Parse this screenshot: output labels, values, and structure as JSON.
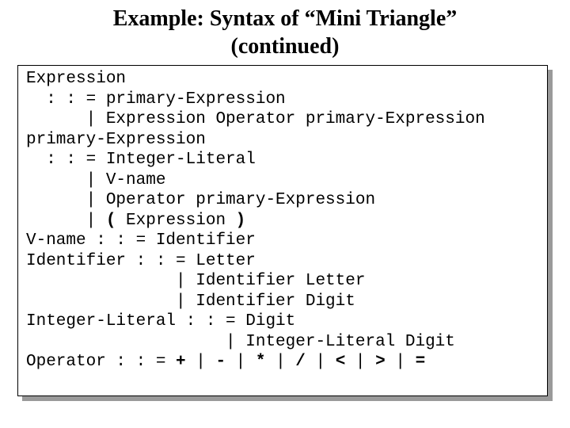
{
  "title_line1": "Example: Syntax of “Mini Triangle”",
  "title_line2": "(continued)",
  "grammar": {
    "l1": "Expression",
    "l2": "  : : = primary-Expression",
    "l3": "      | Expression Operator primary-Expression",
    "l4": "primary-Expression",
    "l5": "  : : = Integer-Literal",
    "l6": "      | V-name",
    "l7": "      | Operator primary-Expression",
    "l8a": "      | ",
    "l8_lpar": "(",
    "l8b": " Expression ",
    "l8_rpar": ")",
    "l9": "V-name : : = Identifier",
    "l10": "Identifier : : = Letter",
    "l11": "               | Identifier Letter",
    "l12": "               | Identifier Digit",
    "l13": "Integer-Literal : : = Digit",
    "l14": "                    | Integer-Literal Digit",
    "op_lead": "Operator : : = ",
    "op_plus": "+",
    "op_sep": " | ",
    "op_minus": "-",
    "op_star": "*",
    "op_slash": "/",
    "op_lt": "<",
    "op_gt": ">",
    "op_eq": "="
  }
}
